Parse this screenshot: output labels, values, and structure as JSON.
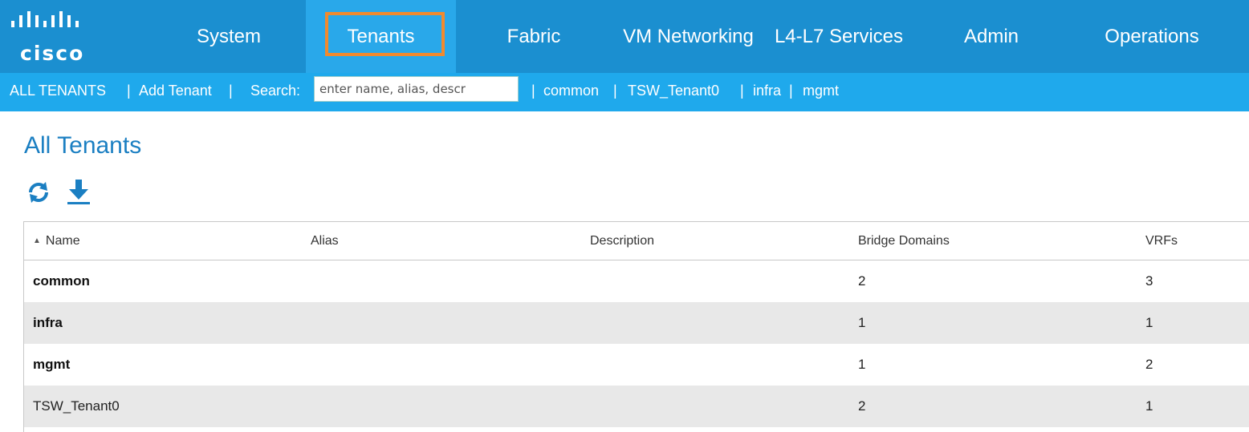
{
  "brand": {
    "logo_text": "cisco",
    "colors": {
      "nav_bg": "#1b8fd0",
      "nav_active": "#29a8ea",
      "subnav_bg": "#1fa9ec",
      "highlight": "#f08a2e",
      "title": "#1b7fc2"
    }
  },
  "topnav": {
    "items": [
      {
        "label": "System"
      },
      {
        "label": "Tenants",
        "active": true
      },
      {
        "label": "Fabric"
      },
      {
        "label": "VM Networking"
      },
      {
        "label": "L4-L7 Services"
      },
      {
        "label": "Admin"
      },
      {
        "label": "Operations"
      }
    ]
  },
  "subnav": {
    "all_tenants": "ALL TENANTS",
    "sep1": "|",
    "add_tenant": "Add Tenant",
    "sep2": "|",
    "search_label": "Search:",
    "search_placeholder": "enter name, alias, descr",
    "sep3": "|",
    "recent": [
      "common",
      "TSW_Tenant0",
      "infra",
      "mgmt"
    ],
    "sep": "|"
  },
  "page": {
    "title": "All Tenants",
    "icons": [
      "refresh-icon",
      "download-icon"
    ]
  },
  "table": {
    "columns": [
      "Name",
      "Alias",
      "Description",
      "Bridge Domains",
      "VRFs"
    ],
    "sort_column": "Name",
    "rows": [
      {
        "name": "common",
        "alias": "",
        "description": "",
        "bridge_domains": "2",
        "vrfs": "3",
        "bold": true
      },
      {
        "name": "infra",
        "alias": "",
        "description": "",
        "bridge_domains": "1",
        "vrfs": "1",
        "bold": true
      },
      {
        "name": "mgmt",
        "alias": "",
        "description": "",
        "bridge_domains": "1",
        "vrfs": "2",
        "bold": true
      },
      {
        "name": "TSW_Tenant0",
        "alias": "",
        "description": "",
        "bridge_domains": "2",
        "vrfs": "1",
        "bold": false
      }
    ]
  }
}
